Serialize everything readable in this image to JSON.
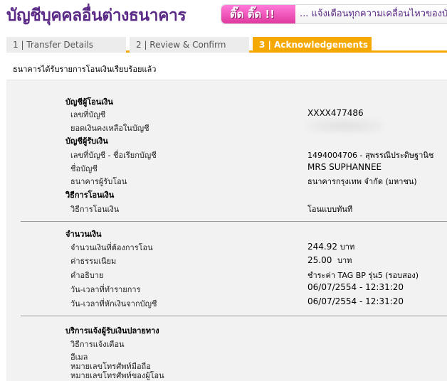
{
  "page": {
    "title": "บัญชีบุคคลอื่นต่างธนาคาร"
  },
  "banner": {
    "badge": "ติ๊ด ติ๊ด !!",
    "text": "... แจ้งเตือนทุกความเคลื่อนไหวของบัญ"
  },
  "tabs": [
    {
      "label": "1 | Transfer Details"
    },
    {
      "label": "2 | Review & Confirm"
    },
    {
      "label": "3 | Acknowledgements"
    }
  ],
  "status_message": "ธนาคารได้รับรายการโอนเงินเรียบร้อยแล้ว",
  "from_account": {
    "heading": "บัญชีผู้โอนเงิน",
    "account_no_label": "เลขที่บัญชี",
    "account_no_value": "XXXX477486",
    "balance_label": "ยอดเงินคงเหลือในบัญชี"
  },
  "to_account": {
    "heading": "บัญชีผู้รับเงิน",
    "account_label": "เลขที่บัญชี - ชื่อเรียกบัญชี",
    "account_value": "1494004706 - สุพรรณีประดิษฐานิช",
    "name_label": "ชื่อบัญชี",
    "name_value": "MRS SUPHANNEE",
    "bank_label": "ธนาคารผู้รับโอน",
    "bank_value": "ธนาคารกรุงเทพ จำกัด (มหาชน)"
  },
  "transfer_method": {
    "heading": "วิธีการโอนเงิน",
    "label": "วิธีการโอนเงิน",
    "value": "โอนแบบทันที"
  },
  "amount": {
    "heading": "จำนวนเงิน",
    "amount_label": "จำนวนเงินที่ต้องการโอน",
    "amount_value": "244.92",
    "amount_unit": "บาท",
    "fee_label": "ค่าธรรมเนียม",
    "fee_value": "25.00",
    "fee_unit": "บาท",
    "desc_label": "คำอธิบาย",
    "desc_value": "ชำระค่า TAG BP รุ่น5 (รอบสอง)",
    "txn_time_label": "วัน-เวลาที่ทำรายการ",
    "txn_time_value": "06/07/2554 - 12:31:20",
    "debit_time_label": "วัน-เวลาที่หักเงินจากบัญชี",
    "debit_time_value": "06/07/2554 - 12:31:20"
  },
  "notify": {
    "heading": "บริการแจ้งผู้รับเงินปลายทาง",
    "method_label": "วิธีการแจ้งเตือน",
    "email_label": "อีเมล",
    "mobile_label": "หมายเลขโทรศัพท์มือถือ",
    "fax_label": "หมายเลขโทรศัพท์ของผู้โอน"
  },
  "colors": {
    "title": "#5a2a86",
    "active_tab": "#f5a800",
    "panel_bg": "#f2f2f2",
    "banner_badge": "#e0399e"
  }
}
